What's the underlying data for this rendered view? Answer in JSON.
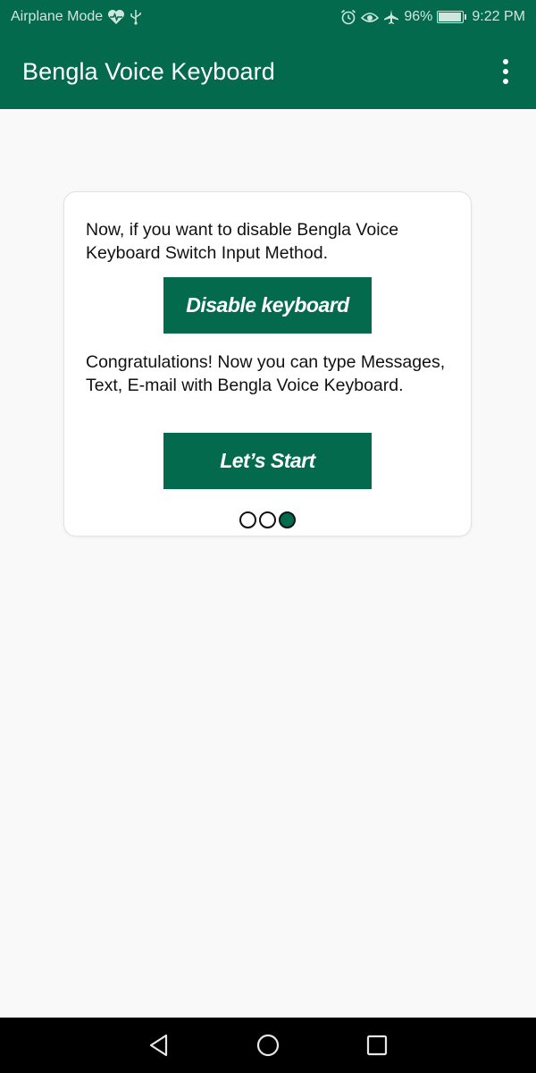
{
  "status_bar": {
    "left_text": "Airplane Mode",
    "battery": "96%",
    "battery_level": 0.96,
    "time": "9:22 PM",
    "icons": [
      "heart-pulse-icon",
      "usb-icon",
      "alarm-icon",
      "eye-icon",
      "airplane-icon",
      "battery-icon"
    ]
  },
  "app_bar": {
    "title": "Bengla Voice Keyboard",
    "menu_icon": "more-vert-icon"
  },
  "card": {
    "text_1": "Now, if you want to disable Bengla Voice Keyboard Switch Input Method.",
    "button_1": "Disable keyboard",
    "text_2": "Congratulations! Now you can type Messages, Text, E-mail with Bengla Voice Keyboard.",
    "button_2": "Let’s Start",
    "page_indicator": {
      "total": 3,
      "current": 3
    }
  },
  "nav_bar": {
    "buttons": [
      "back-icon",
      "home-icon",
      "recents-icon"
    ]
  },
  "colors": {
    "primary": "#036a4e",
    "background": "#f9f9f9",
    "card": "#ffffff",
    "nav_bar": "#000000"
  }
}
